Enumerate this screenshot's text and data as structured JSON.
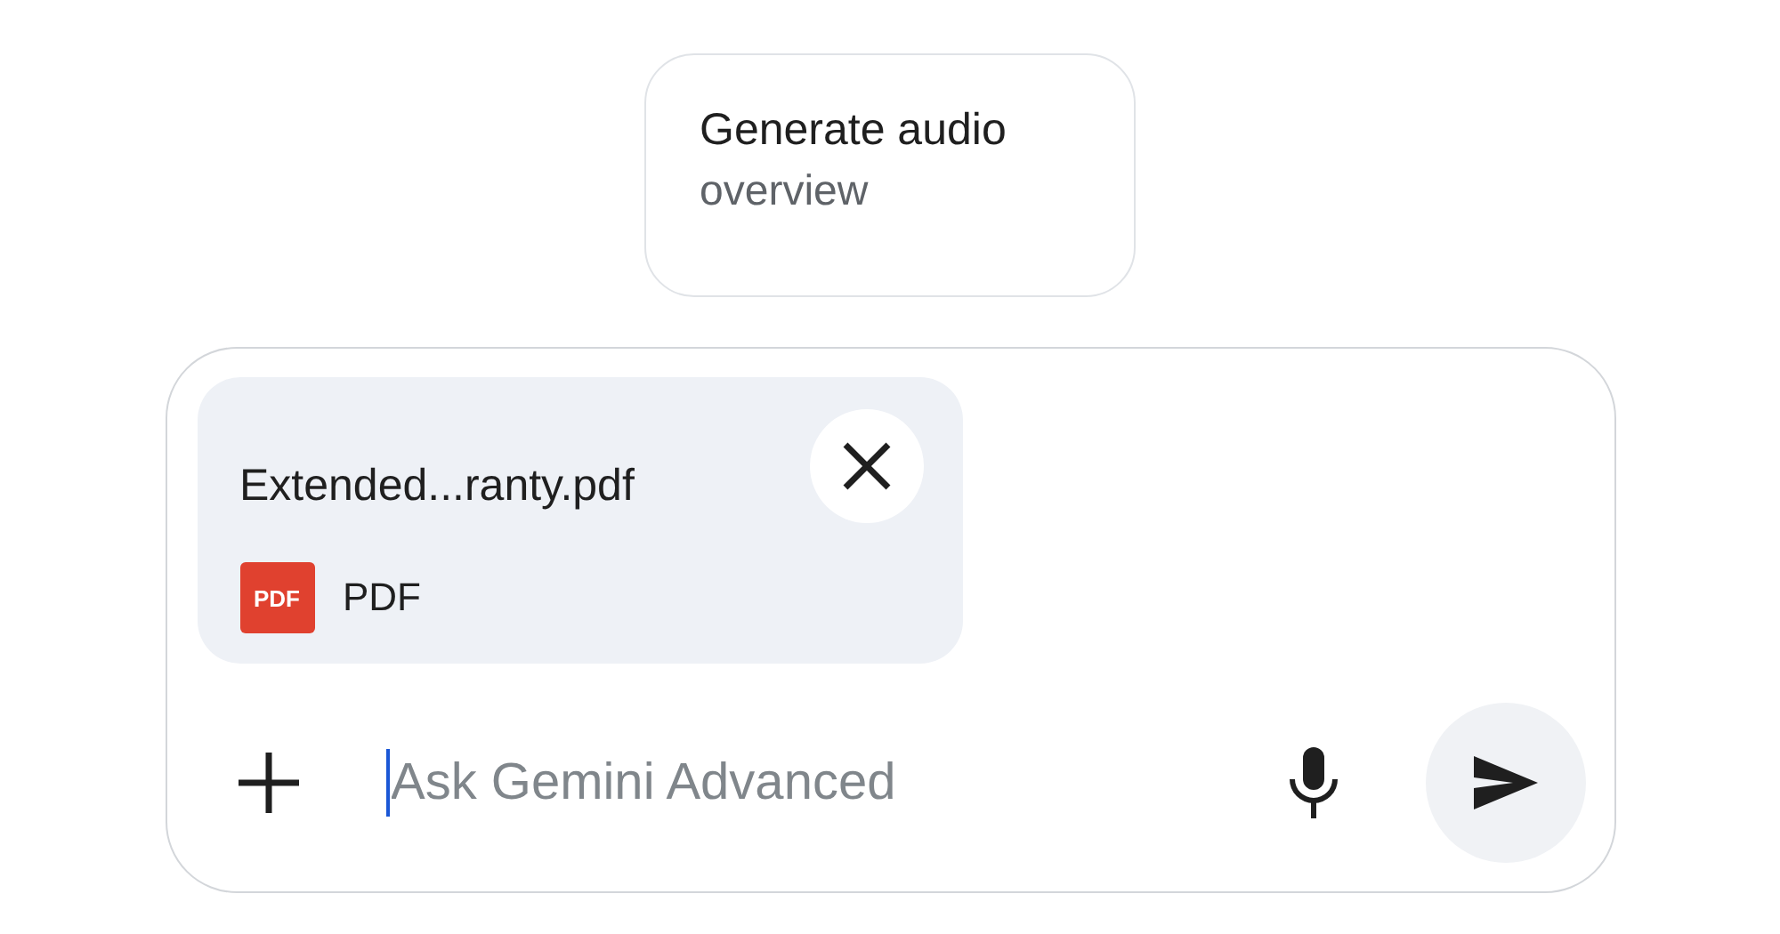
{
  "suggestion": {
    "title": "Generate audio",
    "subtitle": "overview"
  },
  "attachment": {
    "filename": "Extended...ranty.pdf",
    "badge": "PDF",
    "type": "PDF"
  },
  "prompt": {
    "placeholder": "Ask Gemini Advanced",
    "focused": true
  }
}
